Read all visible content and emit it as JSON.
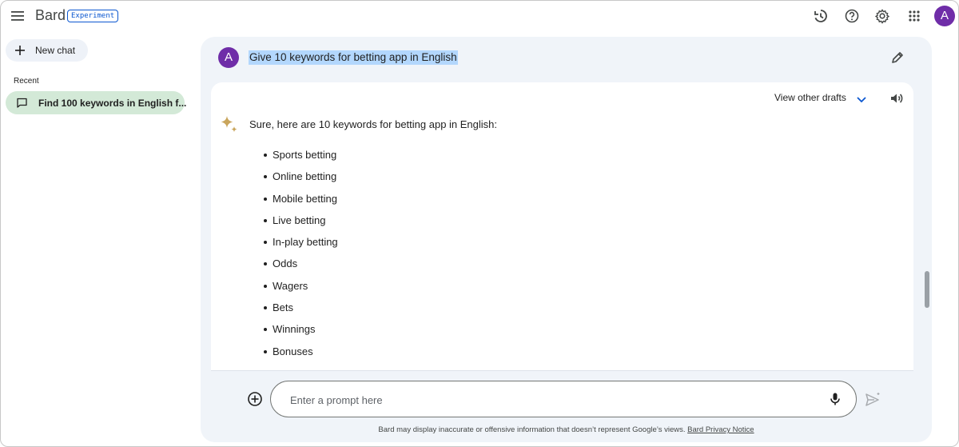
{
  "header": {
    "brand": "Bard",
    "badge": "Experiment",
    "icons": [
      "menu-icon",
      "history-icon",
      "help-icon",
      "settings-icon",
      "apps-icon"
    ],
    "avatar_initial": "A"
  },
  "sidebar": {
    "new_chat_label": "New chat",
    "recent_title": "Recent",
    "recent_items": [
      {
        "label": "Find 100 keywords in English f..."
      }
    ]
  },
  "conversation": {
    "user_avatar_initial": "A",
    "user_message": "Give 10 keywords for betting app in English",
    "view_drafts_label": "View other drafts",
    "response_intro": "Sure, here are 10 keywords for betting app in English:",
    "keywords": [
      "Sports betting",
      "Online betting",
      "Mobile betting",
      "Live betting",
      "In-play betting",
      "Odds",
      "Wagers",
      "Bets",
      "Winnings",
      "Bonuses"
    ]
  },
  "prompt": {
    "placeholder": "Enter a prompt here",
    "value": ""
  },
  "footer": {
    "disclaimer": "Bard may display inaccurate or offensive information that doesn’t represent Google’s views.",
    "privacy_link": "Bard Privacy Notice"
  },
  "colors": {
    "accent": "#0b57d0",
    "avatar": "#6f2da8",
    "recent_active": "#d3e9d7",
    "panel": "#f0f4f9",
    "selection": "#b3d7fd"
  }
}
